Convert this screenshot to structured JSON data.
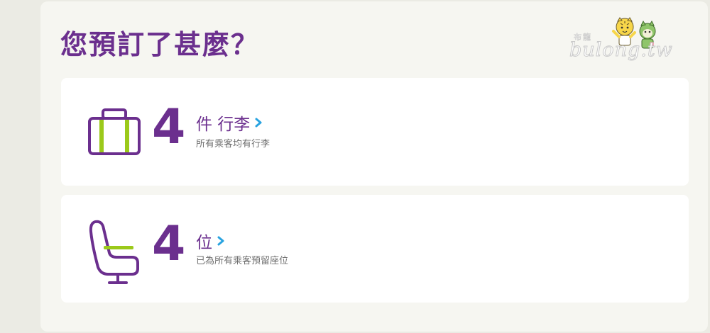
{
  "page": {
    "title": "您預訂了甚麼？"
  },
  "logo": {
    "text": "bulong.tw",
    "sub_text": "布龍"
  },
  "items": [
    {
      "count": "4",
      "label": "件 行李",
      "sub": "所有乘客均有行李",
      "icon": "luggage-icon"
    },
    {
      "count": "4",
      "label": "位",
      "sub": "已為所有乘客預留座位",
      "icon": "seat-icon"
    }
  ],
  "colors": {
    "brand_purple": "#6b2f8e",
    "accent_green": "#9bc91a",
    "chevron_blue": "#29a3e0",
    "panel_bg": "#f6f6f1",
    "page_bg": "#ebebe4",
    "card_bg": "#ffffff"
  }
}
